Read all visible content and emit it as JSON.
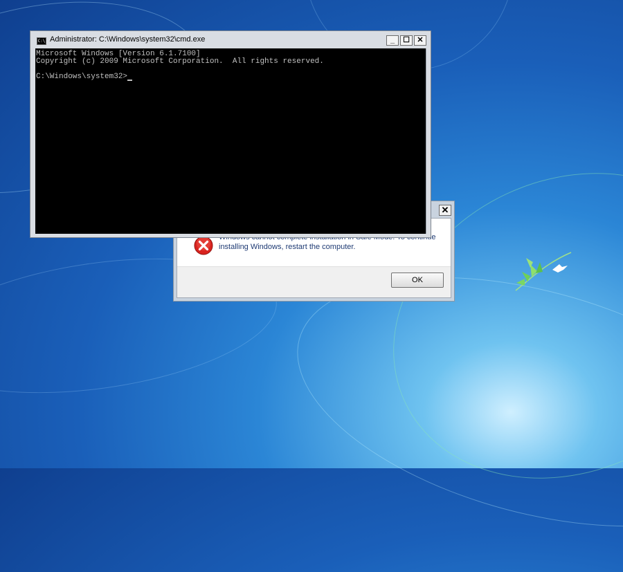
{
  "desktop": {
    "background_colors": [
      "#0f3f8f",
      "#2b86d6",
      "#6fc3f0",
      "#cfefff"
    ]
  },
  "cmd_window": {
    "title": "Administrator: C:\\Windows\\system32\\cmd.exe",
    "icon": "cmd-app-icon",
    "icon_text": "C:\\",
    "buttons": {
      "minimize": "_",
      "maximize": "☐",
      "close": "✕"
    },
    "lines": [
      "Microsoft Windows [Version 6.1.7100]",
      "Copyright (c) 2009 Microsoft Corporation.  All rights reserved.",
      "",
      "C:\\Windows\\system32>"
    ],
    "console_bg": "#000000",
    "console_fg": "#c0c0c0"
  },
  "error_dialog": {
    "close": "✕",
    "message_line1": "Windows cannot complete installation in Safe Mode. To continue",
    "message_line2": "installing Windows, restart the computer.",
    "ok_label": "OK",
    "icon": "error-icon",
    "icon_color": "#d9231f"
  }
}
